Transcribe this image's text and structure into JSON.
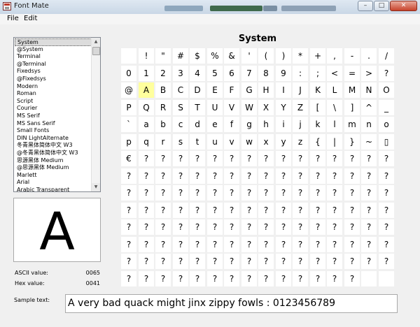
{
  "window": {
    "title": "Font Mate",
    "min_glyph": "–",
    "max_glyph": "□",
    "close_glyph": "✕"
  },
  "menu": [
    "File",
    "Edit"
  ],
  "font_list": {
    "selected_index": 0,
    "items": [
      "System",
      "@System",
      "Terminal",
      "@Terminal",
      "Fixedsys",
      "@Fixedsys",
      "Modern",
      "Roman",
      "Script",
      "Courier",
      "MS Serif",
      "MS Sans Serif",
      "Small Fonts",
      "DIN LightAlternate",
      "冬青黑体简体中文 W3",
      "@冬青黑体简体中文 W3",
      "思源黑体 Medium",
      "@思源黑体 Medium",
      "Marlett",
      "Arial",
      "Arabic Transparent"
    ]
  },
  "preview": {
    "char": "A",
    "ascii_label": "ASCII value:",
    "ascii_value": "0065",
    "hex_label": "Hex value:",
    "hex_value": "0041"
  },
  "grid": {
    "title": "System",
    "selected_char": "A",
    "rows": [
      [
        " ",
        "!",
        "\"",
        "#",
        "$",
        "%",
        "&",
        "'",
        "(",
        ")",
        "*",
        "+",
        ",",
        "-",
        ".",
        "/"
      ],
      [
        "0",
        "1",
        "2",
        "3",
        "4",
        "5",
        "6",
        "7",
        "8",
        "9",
        ":",
        ";",
        "<",
        "=",
        ">",
        "?"
      ],
      [
        "@",
        "A",
        "B",
        "C",
        "D",
        "E",
        "F",
        "G",
        "H",
        "I",
        "J",
        "K",
        "L",
        "M",
        "N",
        "O"
      ],
      [
        "P",
        "Q",
        "R",
        "S",
        "T",
        "U",
        "V",
        "W",
        "X",
        "Y",
        "Z",
        "[",
        "\\",
        "]",
        "^",
        "_"
      ],
      [
        "`",
        "a",
        "b",
        "c",
        "d",
        "e",
        "f",
        "g",
        "h",
        "i",
        "j",
        "k",
        "l",
        "m",
        "n",
        "o"
      ],
      [
        "p",
        "q",
        "r",
        "s",
        "t",
        "u",
        "v",
        "w",
        "x",
        "y",
        "z",
        "{",
        "|",
        "}",
        "~",
        "▯"
      ],
      [
        "€",
        "?",
        "?",
        "?",
        "?",
        "?",
        "?",
        "?",
        "?",
        "?",
        "?",
        "?",
        "?",
        "?",
        "?",
        "?"
      ],
      [
        "?",
        "?",
        "?",
        "?",
        "?",
        "?",
        "?",
        "?",
        "?",
        "?",
        "?",
        "?",
        "?",
        "?",
        "?",
        "?"
      ],
      [
        "?",
        "?",
        "?",
        "?",
        "?",
        "?",
        "?",
        "?",
        "?",
        "?",
        "?",
        "?",
        "?",
        "?",
        "?",
        "?"
      ],
      [
        "?",
        "?",
        "?",
        "?",
        "?",
        "?",
        "?",
        "?",
        "?",
        "?",
        "?",
        "?",
        "?",
        "?",
        "?",
        "?"
      ],
      [
        "?",
        "?",
        "?",
        "?",
        "?",
        "?",
        "?",
        "?",
        "?",
        "?",
        "?",
        "?",
        "?",
        "?",
        "?",
        "?"
      ],
      [
        "?",
        "?",
        "?",
        "?",
        "?",
        "?",
        "?",
        "?",
        "?",
        "?",
        "?",
        "?",
        "?",
        "?",
        "?",
        "?"
      ],
      [
        "?",
        "?",
        "?",
        "?",
        "?",
        "?",
        "?",
        "?",
        "?",
        "?",
        "?",
        "?",
        "?",
        "?",
        "?",
        "?"
      ],
      [
        "?",
        "?",
        "?",
        "?",
        "?",
        "?",
        "?",
        "?",
        "?",
        "?",
        "?",
        "?",
        "?",
        "?",
        " ",
        " "
      ]
    ]
  },
  "sample": {
    "label": "Sample text:",
    "value": "A very bad quack might jinx zippy fowls : 0123456789"
  },
  "colors": {
    "selected_cell": "#ffff9d",
    "title_bar": "#c9d7e6",
    "close_button": "#c7432c"
  }
}
